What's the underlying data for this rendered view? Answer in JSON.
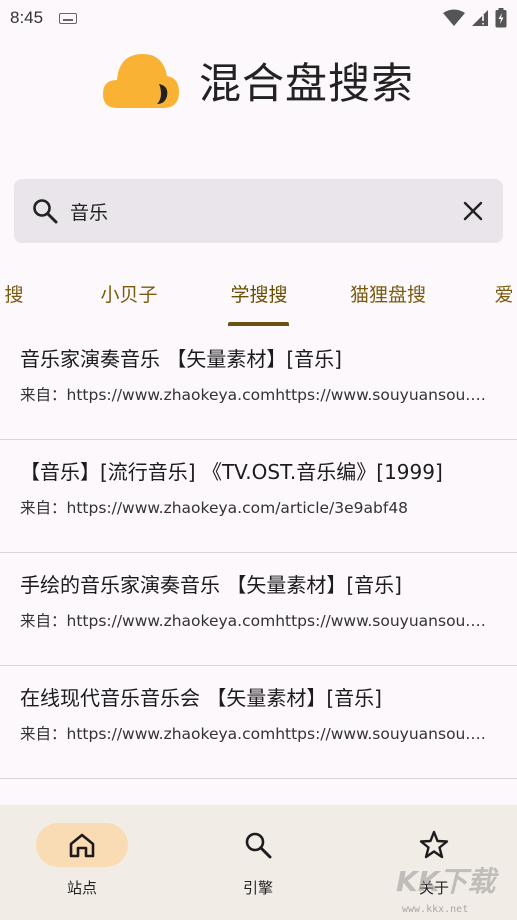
{
  "status_bar": {
    "time": "8:45"
  },
  "app": {
    "title": "混合盘搜索"
  },
  "search": {
    "value": "音乐"
  },
  "tabs": [
    {
      "label": "搜"
    },
    {
      "label": "小贝子"
    },
    {
      "label": "学搜搜"
    },
    {
      "label": "猫狸盘搜"
    },
    {
      "label": "爱"
    }
  ],
  "active_tab": "学搜搜",
  "results": [
    {
      "title": "音乐家演奏音乐 【矢量素材】[音乐]",
      "source": "来自：https://www.zhaokeya.comhttps://www.souyuansou.com"
    },
    {
      "title": "【音乐】[流行音乐] 《TV.OST.音乐编》[1999]",
      "source": "来自：https://www.zhaokeya.com/article/3e9abf48"
    },
    {
      "title": "手绘的音乐家演奏音乐 【矢量素材】[音乐]",
      "source": "来自：https://www.zhaokeya.comhttps://www.souyuansou.com"
    },
    {
      "title": "在线现代音乐音乐会 【矢量素材】[音乐]",
      "source": "来自：https://www.zhaokeya.comhttps://www.souyuansou.com"
    }
  ],
  "bottom_nav": [
    {
      "label": "站点",
      "icon": "home-icon",
      "active": true
    },
    {
      "label": "引擎",
      "icon": "search-icon",
      "active": false
    },
    {
      "label": "关于",
      "icon": "star-icon",
      "active": false
    }
  ],
  "watermark": {
    "logo": "KK下载",
    "url": "www.kkx.net"
  },
  "colors": {
    "accent": "#6b5214",
    "logo": "#f9b233",
    "nav_active_bg": "#fadcb4",
    "nav_bg": "#f2ece6",
    "search_bg": "#e9e5ea"
  }
}
